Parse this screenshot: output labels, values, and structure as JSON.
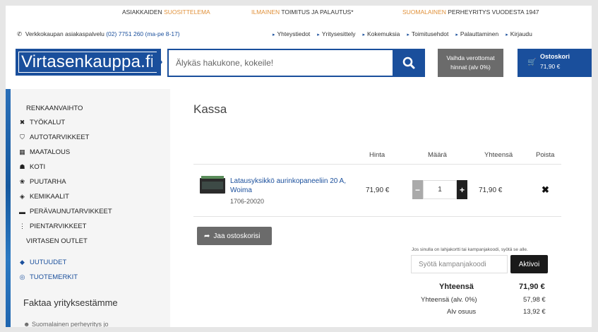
{
  "promo": {
    "item1_plain": "ASIAKKAIDEN ",
    "item1_hl": "SUOSITTELEMA",
    "item2_hl": "ILMAINEN ",
    "item2_plain": "TOIMITUS JA PALAUTUS*",
    "item3_hl": "SUOMALAINEN ",
    "item3_plain": "PERHEYRITYS VUODESTA 1947"
  },
  "contact": {
    "label": "Verkkokaupan asiakaspalvelu ",
    "phone": "(02) 7751 260 (ma-pe 8-17)"
  },
  "nav": {
    "links": [
      "Yhteystiedot",
      "Yritysesittely",
      "Kokemuksia",
      "Toimitusehdot",
      "Palauttaminen",
      "Kirjaudu"
    ]
  },
  "header": {
    "logo": "Virtasenkauppa.fi",
    "search_placeholder": "Älykäs hakukone, kokeile!",
    "vat_line1": "Vaihda verottomat",
    "vat_line2": "hinnat (alv 0%)",
    "cart_label": "Ostoskori",
    "cart_price": "71,90 €"
  },
  "sidebar": {
    "items": [
      {
        "label": "RENKAANVAIHTO",
        "icon": "none"
      },
      {
        "label": "TYÖKALUT",
        "icon": "tools-icon"
      },
      {
        "label": "AUTOTARVIKKEET",
        "icon": "car-icon"
      },
      {
        "label": "MAATALOUS",
        "icon": "farm-icon"
      },
      {
        "label": "KOTI",
        "icon": "home-icon"
      },
      {
        "label": "PUUTARHA",
        "icon": "plant-icon"
      },
      {
        "label": "KEMIKAALIT",
        "icon": "drops-icon"
      },
      {
        "label": "PERÄVAUNUTARVIKKEET",
        "icon": "trailer-icon"
      },
      {
        "label": "PIENTARVIKKEET",
        "icon": "small-parts-icon"
      },
      {
        "label": "VIRTASEN OUTLET",
        "icon": "none"
      },
      {
        "label": "UUTUUDET",
        "icon": "tag-icon"
      },
      {
        "label": "TUOTEMERKIT",
        "icon": "brand-icon"
      }
    ],
    "heading": "Faktaa yrityksestämme",
    "sub": "Suomalainen perheyritys jo"
  },
  "main": {
    "title": "Kassa",
    "headers": {
      "price": "Hinta",
      "qty": "Määrä",
      "total": "Yhteensä",
      "remove": "Poista"
    },
    "product": {
      "name": "Latausyksikkö aurinkopaneeliin 20 A, Woima",
      "sku": "1706-20020",
      "price": "71,90 €",
      "qty": "1",
      "total": "71,90 €"
    },
    "share_label": "Jaa ostoskorisi",
    "coupon_note": "Jos sinulla on lahjakortti tai kampanjakoodi, syötä se alle.",
    "coupon_placeholder": "Syötä kampanjakoodi",
    "activate_label": "Aktivoi",
    "summary": {
      "total_label": "Yhteensä",
      "total_value": "71,90 €",
      "net_label": "Yhteensä (alv. 0%)",
      "net_value": "57,98 €",
      "vat_label": "Alv osuus",
      "vat_value": "13,92 €"
    }
  }
}
